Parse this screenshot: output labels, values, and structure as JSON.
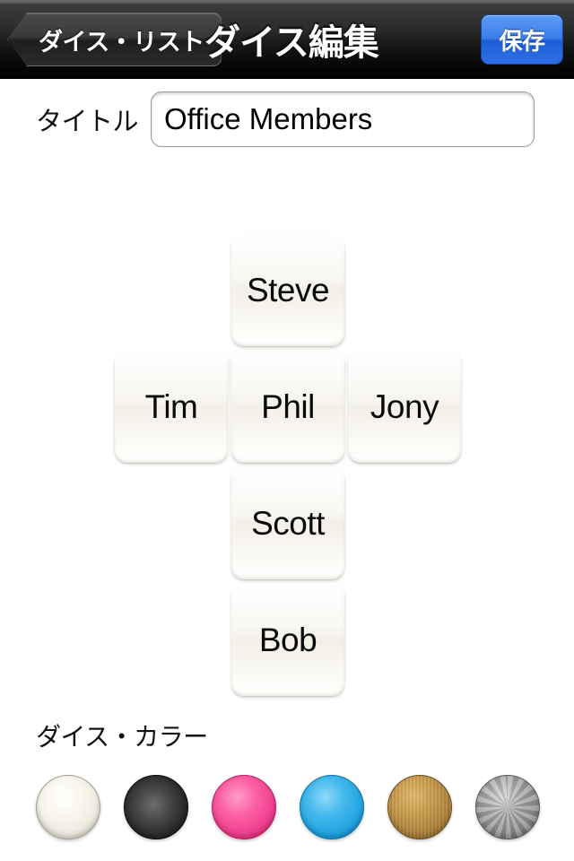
{
  "navbar": {
    "back_label": "ダイス・リスト",
    "title": "ダイス編集",
    "save_label": "保存",
    "save_color": "#3a7de8"
  },
  "title_field": {
    "label": "タイトル",
    "value": "Office Members",
    "placeholder": ""
  },
  "dice_net": {
    "rows": [
      [
        null,
        "Steve",
        null
      ],
      [
        "Tim",
        "Phil",
        "Jony"
      ],
      [
        null,
        "Scott",
        null
      ],
      [
        null,
        "Bob",
        null
      ]
    ],
    "faces": {
      "top": "Steve",
      "left": "Tim",
      "front": "Phil",
      "right": "Jony",
      "bottom": "Scott",
      "back": "Bob"
    }
  },
  "color_section": {
    "label": "ダイス・カラー",
    "swatches": [
      {
        "name": "ivory",
        "hex": "#f3f0e4"
      },
      {
        "name": "black",
        "hex": "#2a2a2a"
      },
      {
        "name": "pink",
        "hex": "#ef3d8e"
      },
      {
        "name": "blue",
        "hex": "#20a3e0"
      },
      {
        "name": "gold",
        "hex": "#c79a4a"
      },
      {
        "name": "silver",
        "hex": "#9a9a9a"
      }
    ]
  }
}
